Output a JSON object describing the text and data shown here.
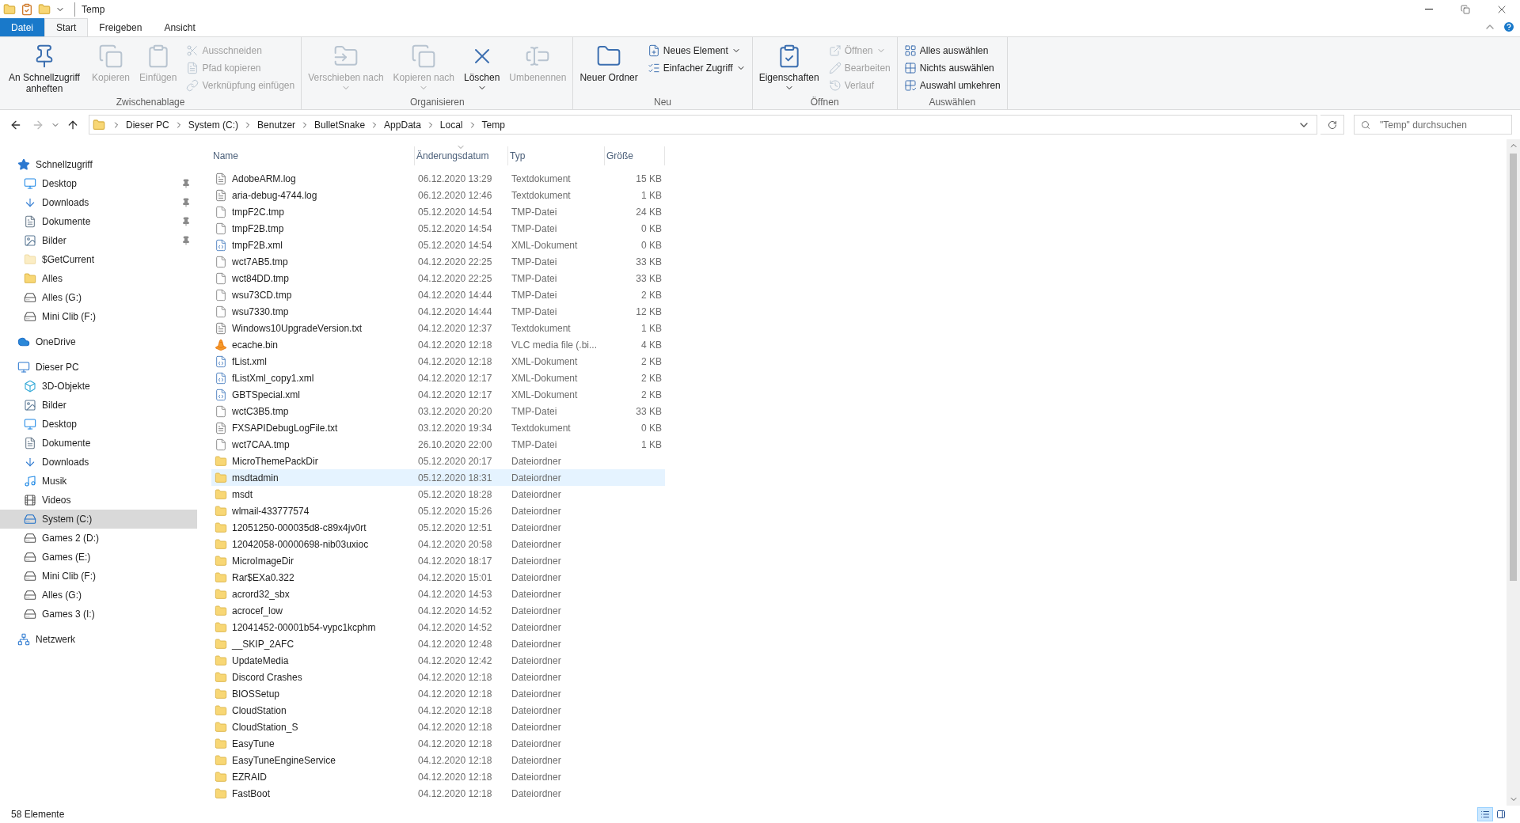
{
  "window": {
    "title": "Temp"
  },
  "ribbon_tabs": [
    {
      "label": "Datei",
      "kind": "file",
      "selected": false
    },
    {
      "label": "Start",
      "kind": "tab",
      "selected": true
    },
    {
      "label": "Freigeben",
      "kind": "tab",
      "selected": false
    },
    {
      "label": "Ansicht",
      "kind": "tab",
      "selected": false
    }
  ],
  "ribbon": {
    "groups": [
      {
        "label": "Zwischenablage",
        "commands": [
          {
            "label": "An Schnellzugriff anheften",
            "kind": "large",
            "disabled": false,
            "dropdown": false
          },
          {
            "label": "Kopieren",
            "kind": "large",
            "disabled": true,
            "dropdown": false
          },
          {
            "label": "Einfügen",
            "kind": "large",
            "disabled": true,
            "dropdown": false
          },
          {
            "label": "Ausschneiden",
            "kind": "small",
            "disabled": true,
            "dropdown": false
          },
          {
            "label": "Pfad kopieren",
            "kind": "small",
            "disabled": true,
            "dropdown": false
          },
          {
            "label": "Verknüpfung einfügen",
            "kind": "small",
            "disabled": true,
            "dropdown": false
          }
        ]
      },
      {
        "label": "Organisieren",
        "commands": [
          {
            "label": "Verschieben nach",
            "kind": "large",
            "disabled": true,
            "dropdown": true
          },
          {
            "label": "Kopieren nach",
            "kind": "large",
            "disabled": true,
            "dropdown": true
          },
          {
            "label": "Löschen",
            "kind": "large",
            "disabled": false,
            "dropdown": true
          },
          {
            "label": "Umbenennen",
            "kind": "large",
            "disabled": true,
            "dropdown": false
          }
        ]
      },
      {
        "label": "Neu",
        "commands": [
          {
            "label": "Neuer Ordner",
            "kind": "large",
            "disabled": false,
            "dropdown": false
          },
          {
            "label": "Neues Element",
            "kind": "small",
            "disabled": false,
            "dropdown": true
          },
          {
            "label": "Einfacher Zugriff",
            "kind": "small",
            "disabled": false,
            "dropdown": true
          }
        ]
      },
      {
        "label": "Öffnen",
        "commands": [
          {
            "label": "Eigenschaften",
            "kind": "large",
            "disabled": false,
            "dropdown": true
          },
          {
            "label": "Öffnen",
            "kind": "small",
            "disabled": true,
            "dropdown": true
          },
          {
            "label": "Bearbeiten",
            "kind": "small",
            "disabled": true,
            "dropdown": false
          },
          {
            "label": "Verlauf",
            "kind": "small",
            "disabled": true,
            "dropdown": false
          }
        ]
      },
      {
        "label": "Auswählen",
        "commands": [
          {
            "label": "Alles auswählen",
            "kind": "small",
            "disabled": false,
            "dropdown": false
          },
          {
            "label": "Nichts auswählen",
            "kind": "small",
            "disabled": false,
            "dropdown": false
          },
          {
            "label": "Auswahl umkehren",
            "kind": "small",
            "disabled": false,
            "dropdown": false
          }
        ]
      }
    ]
  },
  "address": {
    "crumbs": [
      "Dieser PC",
      "System (C:)",
      "Benutzer",
      "BulletSnake",
      "AppData",
      "Local",
      "Temp"
    ]
  },
  "search": {
    "placeholder": "\"Temp\" durchsuchen"
  },
  "sidebar": {
    "items": [
      {
        "label": "Schnellzugriff",
        "kind": "quick-access",
        "selected": false,
        "children": [
          {
            "label": "Desktop",
            "kind": "desktop",
            "selected": false,
            "pinned": true
          },
          {
            "label": "Downloads",
            "kind": "downloads",
            "selected": false,
            "pinned": true
          },
          {
            "label": "Dokumente",
            "kind": "documents",
            "selected": false,
            "pinned": true
          },
          {
            "label": "Bilder",
            "kind": "pictures",
            "selected": false,
            "pinned": true
          },
          {
            "label": "$GetCurrent",
            "kind": "hidden-folder",
            "selected": false,
            "pinned": false
          },
          {
            "label": "Alles",
            "kind": "folder",
            "selected": false,
            "pinned": false
          },
          {
            "label": "Alles (G:)",
            "kind": "drive",
            "selected": false,
            "pinned": false
          },
          {
            "label": "Mini Clib (F:)",
            "kind": "drive",
            "selected": false,
            "pinned": false
          }
        ]
      },
      {
        "label": "OneDrive",
        "kind": "cloud",
        "selected": false
      },
      {
        "label": "Dieser PC",
        "kind": "pc",
        "selected": false,
        "children": [
          {
            "label": "3D-Objekte",
            "kind": "objects",
            "selected": false
          },
          {
            "label": "Bilder",
            "kind": "pictures",
            "selected": false
          },
          {
            "label": "Desktop",
            "kind": "desktop",
            "selected": false
          },
          {
            "label": "Dokumente",
            "kind": "documents",
            "selected": false
          },
          {
            "label": "Downloads",
            "kind": "downloads",
            "selected": false
          },
          {
            "label": "Musik",
            "kind": "music",
            "selected": false
          },
          {
            "label": "Videos",
            "kind": "videos",
            "selected": false
          },
          {
            "label": "System (C:)",
            "kind": "system-drive",
            "selected": true
          },
          {
            "label": "Games 2 (D:)",
            "kind": "drive",
            "selected": false
          },
          {
            "label": "Games (E:)",
            "kind": "drive",
            "selected": false
          },
          {
            "label": "Mini Clib (F:)",
            "kind": "drive",
            "selected": false
          },
          {
            "label": "Alles (G:)",
            "kind": "drive",
            "selected": false
          },
          {
            "label": "Games 3 (I:)",
            "kind": "drive",
            "selected": false
          }
        ]
      },
      {
        "label": "Netzwerk",
        "kind": "network",
        "selected": false
      }
    ]
  },
  "files": {
    "columns": [
      {
        "label": "Name",
        "sorted": false
      },
      {
        "label": "Änderungsdatum",
        "sorted": true
      },
      {
        "label": "Typ",
        "sorted": false
      },
      {
        "label": "Größe",
        "sorted": false
      }
    ],
    "rows": [
      {
        "name": "AdobeARM.log",
        "date": "06.12.2020 13:29",
        "type": "Textdokument",
        "size": "15 KB",
        "kind": "text",
        "selected": false
      },
      {
        "name": "aria-debug-4744.log",
        "date": "06.12.2020 12:46",
        "type": "Textdokument",
        "size": "1 KB",
        "kind": "text",
        "selected": false
      },
      {
        "name": "tmpF2C.tmp",
        "date": "05.12.2020 14:54",
        "type": "TMP-Datei",
        "size": "24 KB",
        "kind": "blank",
        "selected": false
      },
      {
        "name": "tmpF2B.tmp",
        "date": "05.12.2020 14:54",
        "type": "TMP-Datei",
        "size": "0 KB",
        "kind": "blank",
        "selected": false
      },
      {
        "name": "tmpF2B.xml",
        "date": "05.12.2020 14:54",
        "type": "XML-Dokument",
        "size": "0 KB",
        "kind": "xml",
        "selected": false
      },
      {
        "name": "wct7AB5.tmp",
        "date": "04.12.2020 22:25",
        "type": "TMP-Datei",
        "size": "33 KB",
        "kind": "blank",
        "selected": false
      },
      {
        "name": "wct84DD.tmp",
        "date": "04.12.2020 22:25",
        "type": "TMP-Datei",
        "size": "33 KB",
        "kind": "blank",
        "selected": false
      },
      {
        "name": "wsu73CD.tmp",
        "date": "04.12.2020 14:44",
        "type": "TMP-Datei",
        "size": "2 KB",
        "kind": "blank",
        "selected": false
      },
      {
        "name": "wsu7330.tmp",
        "date": "04.12.2020 14:44",
        "type": "TMP-Datei",
        "size": "12 KB",
        "kind": "blank",
        "selected": false
      },
      {
        "name": "Windows10UpgradeVersion.txt",
        "date": "04.12.2020 12:37",
        "type": "Textdokument",
        "size": "1 KB",
        "kind": "text",
        "selected": false
      },
      {
        "name": "ecache.bin",
        "date": "04.12.2020 12:18",
        "type": "VLC media file (.bi...",
        "size": "4 KB",
        "kind": "vlc",
        "selected": false
      },
      {
        "name": "fList.xml",
        "date": "04.12.2020 12:18",
        "type": "XML-Dokument",
        "size": "2 KB",
        "kind": "xml",
        "selected": false
      },
      {
        "name": "fListXml_copy1.xml",
        "date": "04.12.2020 12:17",
        "type": "XML-Dokument",
        "size": "2 KB",
        "kind": "xml",
        "selected": false
      },
      {
        "name": "GBTSpecial.xml",
        "date": "04.12.2020 12:17",
        "type": "XML-Dokument",
        "size": "2 KB",
        "kind": "xml",
        "selected": false
      },
      {
        "name": "wctC3B5.tmp",
        "date": "03.12.2020 20:20",
        "type": "TMP-Datei",
        "size": "33 KB",
        "kind": "blank",
        "selected": false
      },
      {
        "name": "FXSAPIDebugLogFile.txt",
        "date": "03.12.2020 19:34",
        "type": "Textdokument",
        "size": "0 KB",
        "kind": "text",
        "selected": false
      },
      {
        "name": "wct7CAA.tmp",
        "date": "26.10.2020 22:00",
        "type": "TMP-Datei",
        "size": "1 KB",
        "kind": "blank",
        "selected": false
      },
      {
        "name": "MicroThemePackDir",
        "date": "05.12.2020 20:17",
        "type": "Dateiordner",
        "kind": "folder",
        "selected": false
      },
      {
        "name": "msdtadmin",
        "date": "05.12.2020 18:31",
        "type": "Dateiordner",
        "kind": "folder",
        "selected": true
      },
      {
        "name": "msdt",
        "date": "05.12.2020 18:28",
        "type": "Dateiordner",
        "kind": "folder",
        "selected": false
      },
      {
        "name": "wlmail-433777574",
        "date": "05.12.2020 15:26",
        "type": "Dateiordner",
        "kind": "folder",
        "selected": false
      },
      {
        "name": "12051250-000035d8-c89x4jv0rt",
        "date": "05.12.2020 12:51",
        "type": "Dateiordner",
        "kind": "folder",
        "selected": false
      },
      {
        "name": "12042058-00000698-nib03uxioc",
        "date": "04.12.2020 20:58",
        "type": "Dateiordner",
        "kind": "folder",
        "selected": false
      },
      {
        "name": "MicroImageDir",
        "date": "04.12.2020 18:17",
        "type": "Dateiordner",
        "kind": "folder",
        "selected": false
      },
      {
        "name": "Rar$EXa0.322",
        "date": "04.12.2020 15:01",
        "type": "Dateiordner",
        "kind": "folder",
        "selected": false
      },
      {
        "name": "acrord32_sbx",
        "date": "04.12.2020 14:53",
        "type": "Dateiordner",
        "kind": "folder",
        "selected": false
      },
      {
        "name": "acrocef_low",
        "date": "04.12.2020 14:52",
        "type": "Dateiordner",
        "kind": "folder",
        "selected": false
      },
      {
        "name": "12041452-00001b54-vypc1kcphm",
        "date": "04.12.2020 14:52",
        "type": "Dateiordner",
        "kind": "folder",
        "selected": false
      },
      {
        "name": "__SKIP_2AFC",
        "date": "04.12.2020 12:48",
        "type": "Dateiordner",
        "kind": "folder",
        "selected": false
      },
      {
        "name": "UpdateMedia",
        "date": "04.12.2020 12:42",
        "type": "Dateiordner",
        "kind": "folder",
        "selected": false
      },
      {
        "name": "Discord Crashes",
        "date": "04.12.2020 12:18",
        "type": "Dateiordner",
        "kind": "folder",
        "selected": false
      },
      {
        "name": "BIOSSetup",
        "date": "04.12.2020 12:18",
        "type": "Dateiordner",
        "kind": "folder",
        "selected": false
      },
      {
        "name": "CloudStation",
        "date": "04.12.2020 12:18",
        "type": "Dateiordner",
        "kind": "folder",
        "selected": false
      },
      {
        "name": "CloudStation_S",
        "date": "04.12.2020 12:18",
        "type": "Dateiordner",
        "kind": "folder",
        "selected": false
      },
      {
        "name": "EasyTune",
        "date": "04.12.2020 12:18",
        "type": "Dateiordner",
        "kind": "folder",
        "selected": false
      },
      {
        "name": "EasyTuneEngineService",
        "date": "04.12.2020 12:18",
        "type": "Dateiordner",
        "kind": "folder",
        "selected": false
      },
      {
        "name": "EZRAID",
        "date": "04.12.2020 12:18",
        "type": "Dateiordner",
        "kind": "folder",
        "selected": false
      },
      {
        "name": "FastBoot",
        "date": "04.12.2020 12:18",
        "type": "Dateiordner",
        "kind": "folder",
        "selected": false
      }
    ]
  },
  "status_bar": {
    "count": "58 Elemente",
    "views": [
      {
        "selected": true
      },
      {
        "selected": false
      }
    ]
  }
}
